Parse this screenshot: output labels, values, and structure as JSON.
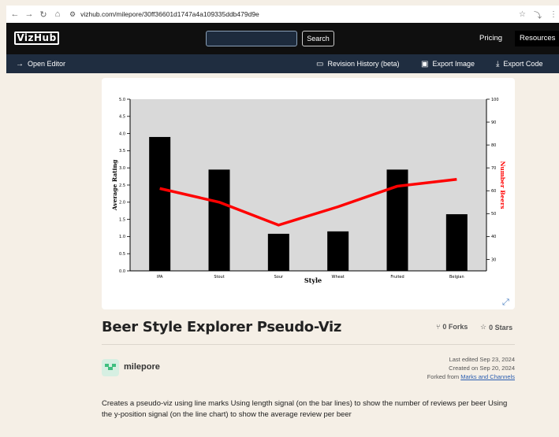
{
  "browser": {
    "url": "vizhub.com/milepore/30ff36601d1747a4a109335ddb479d9e",
    "back_glyph": "←",
    "forward_glyph": "→",
    "reload_glyph": "↻",
    "home_glyph": "⌂",
    "star_glyph": "☆"
  },
  "header": {
    "logo": "VizHub",
    "search_placeholder": "",
    "search_button": "Search",
    "pricing": "Pricing",
    "resources": "Resources"
  },
  "toolbar": {
    "open_editor": "Open Editor",
    "revision_history": "Revision History (beta)",
    "export_image": "Export Image",
    "export_code": "Export Code"
  },
  "viz": {
    "title": "Beer Style Explorer Pseudo-Viz",
    "forks": "0 Forks",
    "stars": "0 Stars",
    "author": "milepore",
    "last_edited": "Last edited Sep 23, 2024",
    "created": "Created on Sep 20, 2024",
    "forked_from_prefix": "Forked from ",
    "forked_from_link": "Marks and Channels",
    "description": "Creates a pseudo-viz using line marks Using length signal (on the bar lines) to show the number of reviews per beer Using the y-position signal (on the line chart) to show the average review per beer"
  },
  "chart_data": {
    "type": "bar",
    "categories": [
      "IPA",
      "Stout",
      "Sour",
      "Wheat",
      "Fruited",
      "Belgian"
    ],
    "series": [
      {
        "values": [
          3.9,
          2.95,
          1.08,
          1.15,
          2.95,
          1.65
        ],
        "axis": "left",
        "mark": "bar",
        "color": "#000000"
      },
      {
        "values": [
          61,
          55,
          45,
          53,
          62,
          65
        ],
        "axis": "right",
        "mark": "line",
        "color": "#ff0000"
      }
    ],
    "xlabel": "Style",
    "ylabel": "Average Rating",
    "y2label": "Number Beers",
    "ylim": [
      0,
      5
    ],
    "y2lim": [
      25,
      100
    ],
    "yticks": [
      "0.0",
      "0.5",
      "1.0",
      "1.5",
      "2.0",
      "2.5",
      "3.0",
      "3.5",
      "4.0",
      "4.5",
      "5.0"
    ],
    "y2ticks": [
      "30",
      "40",
      "50",
      "60",
      "70",
      "80",
      "90",
      "100"
    ],
    "plot_background": "#d9d9d9"
  }
}
